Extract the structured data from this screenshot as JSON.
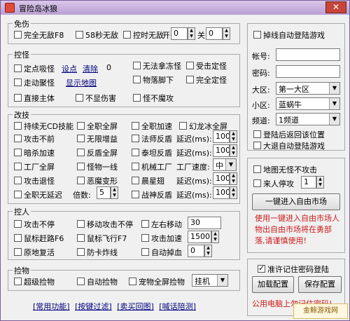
{
  "window": {
    "title": "冒险岛冰狼",
    "close_label": "✕"
  },
  "mianshang": {
    "legend": "免伤",
    "full_invincible": "完全无敌F8",
    "sec58": "58秒无敌",
    "timed_invincible": "控时无敌",
    "open_label": "开",
    "open_value": "0",
    "close_label": "关",
    "close_value": "0"
  },
  "kongguai": {
    "legend": "控怪",
    "fixed_vacuum": "定点吸怪",
    "set_point": "设点",
    "clear": "清除",
    "count": "0",
    "walk_vacuum": "走动聚怪",
    "show_map": "显示地图",
    "no_knockback": "无法拿冻怪",
    "hit_fixed": "受击定怪",
    "under_feet": "物落脚下",
    "full_fixed": "完全定怪",
    "hit_body": "直接主体",
    "no_damage": "不显伤害",
    "monster_no_attack": "怪不魔攻"
  },
  "gaiji": {
    "legend": "改技",
    "no_cd": "持续无CD技能",
    "full_screen": "全职全屏",
    "full_accel": "全职加速",
    "ice_dragon": "幻龙冰全屏",
    "attack_nonstop": "攻击不前",
    "unlimited_buff": "无限增益",
    "mage_reflect": "法师反盾",
    "delay_ms": "延迟(ms):",
    "delay_val1": "100",
    "dark_accel": "暗杀加速",
    "reflect_full": "反盾全屏",
    "thief_reflect": "泰坦反盾",
    "delay_val2": "100",
    "workshop_full": "工厂全屏",
    "monster_line": "怪物一线",
    "machine_factory": "机械工厂",
    "factory_speed": "工厂速度:",
    "factory_speed_val": "中",
    "attack_back": "攻击退怪",
    "demon_transform": "恶魔变形",
    "wing_dawn": "晨星翅",
    "delay_val3": "100",
    "full_no_delay": "全职无延迟",
    "multiplier_label": "倍数:",
    "multiplier_val": "5",
    "war_god": "战神反盾",
    "delay_val4": "100"
  },
  "kongren": {
    "legend": "控人",
    "attack_nonstop": "攻击不停",
    "move_attack_nonstop": "移动攻击不停",
    "left_right_move": "左右移动",
    "move_val": "30",
    "mouse_route": "鼠标赶路F6",
    "mouse_fly": "鼠标飞行F7",
    "attack_accel": "攻击加速",
    "accel_val": "1500",
    "revive": "原地复活",
    "anti_card": "防卡炸线",
    "auto_heal": "自动掉血",
    "heal_val": "0"
  },
  "jianwu": {
    "legend": "捡物",
    "super_pickup": "超级捡物",
    "auto_pickup": "自动捡物",
    "pet_full_pickup": "宠物全屏捡物",
    "pickup_mode": "挂机"
  },
  "login": {
    "auto_login": "掉线自动登陆游戏",
    "account_label": "帐号:",
    "account_val": "",
    "password_label": "密码:",
    "password_val": "",
    "region_label": "大区:",
    "region_val": "第一大区",
    "subregion_label": "小区:",
    "subregion_val": "蓝蜗牛",
    "channel_label": "频道:",
    "channel_val": "1频道",
    "return_pos": "登陆后返回该位置",
    "auto_relogin": "大退自动登陆游戏"
  },
  "market": {
    "map_no_attack": "地图无怪不攻击",
    "player_stop": "来人停攻",
    "player_stop_val": "1",
    "enter_market_button": "一键进入自由市场",
    "warning": "使用一键进入自由市场人物出自由市场将在勇部落,请谨慎使用!"
  },
  "config": {
    "remember_password": "准许记住密码登陆",
    "load_button": "加载配置",
    "save_button": "保存配置",
    "public_warning": "公用电脑上勿记住密码!"
  },
  "bottom_links": [
    "[常用功能]",
    "[按键过滤]",
    "[卖买回图]",
    "[喊话陪测]"
  ],
  "watermark": "金鲸游戏网"
}
